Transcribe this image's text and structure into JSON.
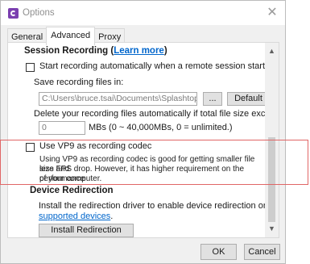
{
  "window": {
    "title": "Options",
    "close_glyph": "✕"
  },
  "tabs": [
    {
      "label": "General"
    },
    {
      "label": "Advanced",
      "active": true
    },
    {
      "label": "Proxy"
    }
  ],
  "session_recording": {
    "heading": "Session Recording (",
    "link": "Learn more",
    "heading_end": ")",
    "auto_record_label": "Start recording automatically when a remote session starts",
    "auto_record_checked": false,
    "save_label": "Save recording files in:",
    "save_path": "C:\\Users\\bruce.tsai\\Documents\\Splashtop B",
    "browse_label": "...",
    "default_label": "Default",
    "delete_label": "Delete your recording files automatically if total file size exceeds:",
    "size_value": "0",
    "size_hint": "MBs (0 ~ 40,000MBs, 0 = unlimited.)",
    "vp9_label": "Use VP9 as recording codec",
    "vp9_checked": false,
    "vp9_desc_1": "Using VP9 as recording codec is good for getting smaller file size and",
    "vp9_desc_2": "less FPS drop. However, it has higher requirement on the performance",
    "vp9_desc_3": "of your computer."
  },
  "device_redirection": {
    "heading": "Device Redirection",
    "desc": "Install the redirection driver to enable device redirection on",
    "link": "supported devices",
    "link_end": ".",
    "install_label": "Install Redirection Driver"
  },
  "footer": {
    "ok_label": "OK",
    "cancel_label": "Cancel"
  },
  "colors": {
    "accent": "#7b3fb0",
    "link": "#0066cc",
    "highlight": "#e06666"
  },
  "icons": {
    "app": "splashtop-app-icon",
    "close": "close-icon",
    "scroll_up": "chevron-up-icon",
    "scroll_down": "chevron-down-icon"
  }
}
